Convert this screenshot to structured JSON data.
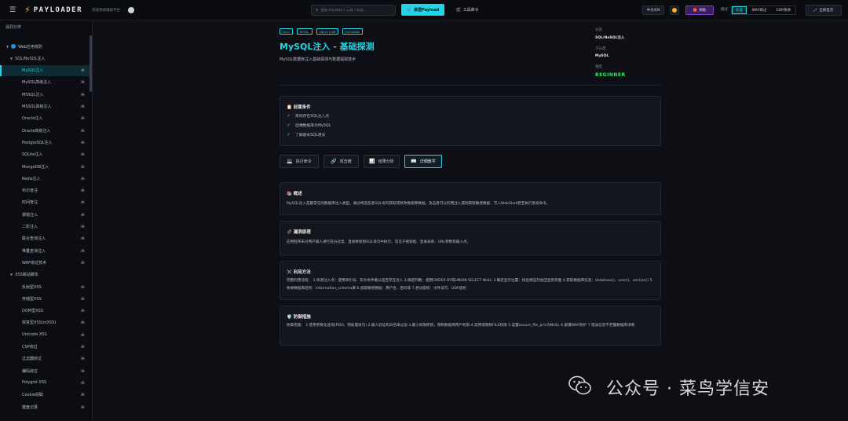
{
  "header": {
    "logo": "PAYLOADER",
    "tagline": "渗透测试辅助平台",
    "search_placeholder": "搜索 Payload / 工具 / 标签...",
    "payload_button": "渗透Payload",
    "tools_button": "工具命令",
    "lang_button": "中文/EN",
    "donate_button": "捐助",
    "mode_label": "模式",
    "modes": [
      "标准",
      "WAF绕过",
      "EDR免杀"
    ],
    "active_mode": "标准",
    "fullscreen_button": "全屏显示"
  },
  "sidebar": {
    "title": "漏洞分类",
    "groups": [
      {
        "label": "Web应用攻防",
        "level": 0
      },
      {
        "label": "SQL/NoSQL注入",
        "level": 1
      },
      {
        "label": "MySQL注入",
        "level": 2,
        "active": true
      },
      {
        "label": "MySQL高级注入",
        "level": 2
      },
      {
        "label": "MSSQL注入",
        "level": 2
      },
      {
        "label": "MSSQL高级注入",
        "level": 2
      },
      {
        "label": "Oracle注入",
        "level": 2
      },
      {
        "label": "Oracle高级注入",
        "level": 2
      },
      {
        "label": "PostgreSQL注入",
        "level": 2
      },
      {
        "label": "SQLite注入",
        "level": 2
      },
      {
        "label": "MongoDB注入",
        "level": 2
      },
      {
        "label": "Redis注入",
        "level": 2
      },
      {
        "label": "布尔盲注",
        "level": 2
      },
      {
        "label": "时间盲注",
        "level": 2
      },
      {
        "label": "报错注入",
        "level": 2
      },
      {
        "label": "二阶注入",
        "level": 2
      },
      {
        "label": "联合查询注入",
        "level": 2
      },
      {
        "label": "堆叠查询注入",
        "level": 2
      },
      {
        "label": "WAF绕过技术",
        "level": 2
      },
      {
        "label": "XSS跨站脚本",
        "level": 1
      },
      {
        "label": "反射型XSS",
        "level": 2
      },
      {
        "label": "存储型XSS",
        "level": 2
      },
      {
        "label": "DOM型XSS",
        "level": 2
      },
      {
        "label": "突变型XSS(mXSS)",
        "level": 2
      },
      {
        "label": "Unicode XSS",
        "level": 2
      },
      {
        "label": "CSP绕过",
        "level": 2
      },
      {
        "label": "过滤器绕过",
        "level": 2
      },
      {
        "label": "编码绕过",
        "level": 2
      },
      {
        "label": "Polyglot XSS",
        "level": 2
      },
      {
        "label": "Cookie窃取",
        "level": 2
      },
      {
        "label": "键盘记录",
        "level": 2
      }
    ]
  },
  "main": {
    "tags": [
      "SQLI",
      "MYSQL",
      "INJECTION",
      "DATABASE"
    ],
    "title": "MySQL注入 - 基础探测",
    "subtitle": "MySQL数据库注入基础探测与数据提取技术",
    "meta": {
      "category_label": "分类",
      "category_value": "SQL/NoSQL注入",
      "subcat_label": "子分类",
      "subcat_value": "MySQL",
      "level_label": "难度",
      "level_value": "BEGINNER"
    },
    "prereq": {
      "title": "前置条件",
      "items": [
        "目标存在SQL注入点",
        "后端数据库为MySQL",
        "了解基本SQL语法"
      ]
    },
    "tabs": [
      {
        "label": "执行命令",
        "icon": "💻"
      },
      {
        "label": "攻击链",
        "icon": "🔗"
      },
      {
        "label": "结果分析",
        "icon": "📊"
      },
      {
        "label": "详细教学",
        "icon": "📖",
        "active": true
      }
    ],
    "sections": [
      {
        "icon": "📚",
        "title": "概述",
        "text": "MySQL注入是最常见的数据库注入类型。通过构造恶意SQL语句获取或修改数据库数据。攻击者可以利用注入漏洞获取敏感数据、写入WebShell甚至执行系统命令。"
      },
      {
        "icon": "💣",
        "title": "漏洞原理",
        "text": "应用程序未对用户输入进行充分过滤，直接拼接到SQL语句中执行。常见于搜索框、登录表单、URL参数等输入点。"
      },
      {
        "icon": "⚔️",
        "title": "利用方法",
        "text": "完整利用流程： 1.探测注入点：使用单引号、布尔条件确认是否存在注入 2.确定列数：使用ORDER BY或UNION SELECT NULL 3.确定显示位置：找出哪些列会回显到页面 4.获取数据库信息：database()、user()、version() 5.枚举数据库结构：information_schema库 6.提取敏感数据：用户名、密码等 7.尝试提权：文件读写、UDF提权"
      },
      {
        "icon": "🛡️",
        "title": "防御措施",
        "text": "防御措施： 1.使用参数化查询(PDO、预处理语句) 2.输入验证和白名单过滤 3.最小权限原则，限制数据库用户权限 4.禁用或限制FILE权限 5.设置secure_file_priv为NULL 6.部署WAF防护 7.错误信息不泄露数据库详情"
      }
    ]
  },
  "watermark": "公众号 · 菜鸟学信安"
}
